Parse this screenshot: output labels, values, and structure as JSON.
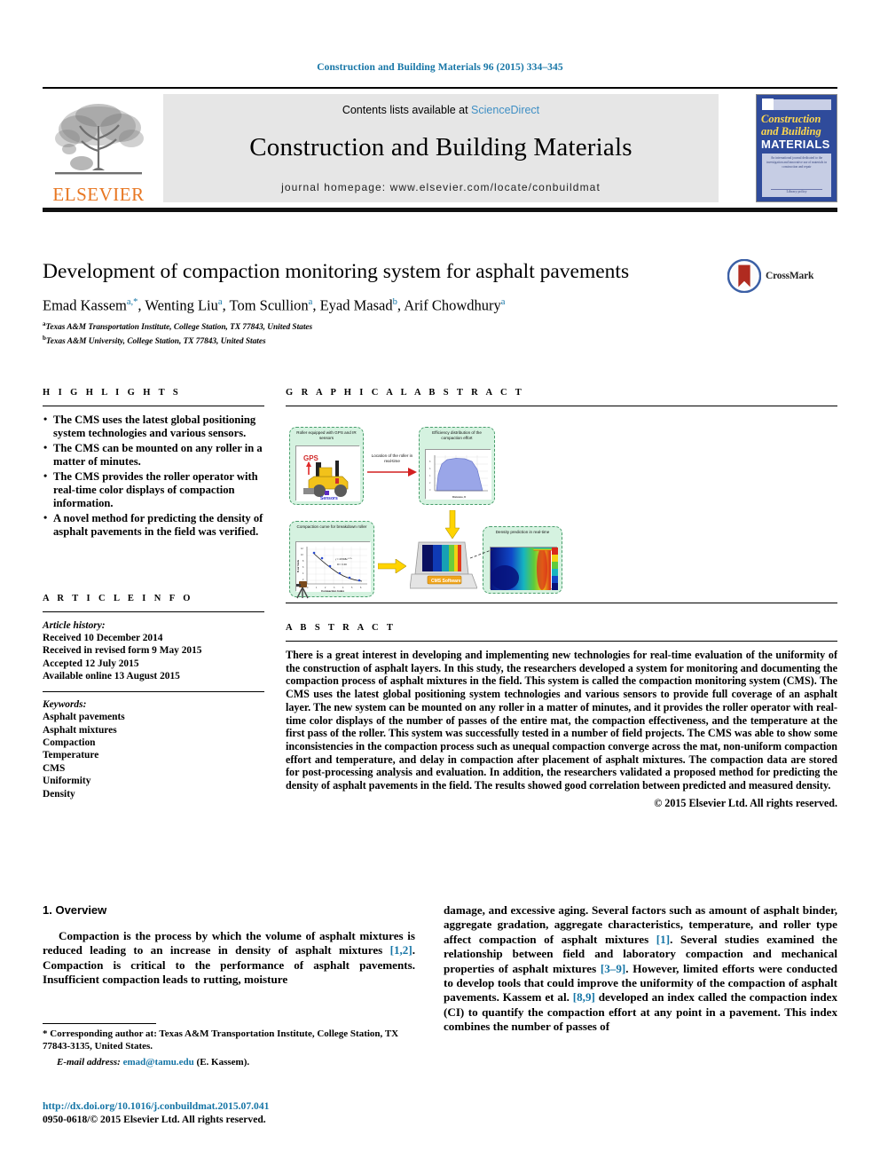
{
  "running_head": "Construction and Building Materials 96 (2015) 334–345",
  "masthead": {
    "contents_prefix": "Contents lists available at ",
    "sciencedirect": "ScienceDirect",
    "journal_title": "Construction and Building Materials",
    "homepage": "journal homepage: www.elsevier.com/locate/conbuildmat",
    "publisher": "ELSEVIER",
    "cover": {
      "line1": "Construction",
      "line2": "and Building",
      "line3": "MATERIALS",
      "blurb": "An international journal dedicated to the investigation and innovative use of materials in construction and repair",
      "foot": "Library policy"
    }
  },
  "article": {
    "title": "Development of compaction monitoring system for asphalt pavements",
    "crossmark_label": "CrossMark",
    "authors": [
      {
        "name": "Emad Kassem",
        "marks": "a,*"
      },
      {
        "name": "Wenting Liu",
        "marks": "a"
      },
      {
        "name": "Tom Scullion",
        "marks": "a"
      },
      {
        "name": "Eyad Masad",
        "marks": "b"
      },
      {
        "name": "Arif Chowdhury",
        "marks": "a"
      }
    ],
    "affiliations": [
      {
        "mark": "a",
        "text": "Texas A&M Transportation Institute, College Station, TX 77843, United States"
      },
      {
        "mark": "b",
        "text": "Texas A&M University, College Station, TX 77843, United States"
      }
    ]
  },
  "highlights": {
    "heading": "H I G H L I G H T S",
    "items": [
      "The CMS uses the latest global positioning system technologies and various sensors.",
      "The CMS can be mounted on any roller in a matter of minutes.",
      "The CMS provides the roller operator with real-time color displays of compaction information.",
      "A novel method for predicting the density of asphalt pavements in the field was verified."
    ]
  },
  "article_info": {
    "heading": "A R T I C L E    I N F O",
    "history_label": "Article history:",
    "history": [
      "Received 10 December 2014",
      "Received in revised form 9 May 2015",
      "Accepted 12 July 2015",
      "Available online 13 August 2015"
    ],
    "keywords_label": "Keywords:",
    "keywords": [
      "Asphalt pavements",
      "Asphalt mixtures",
      "Compaction",
      "Temperature",
      "CMS",
      "Uniformity",
      "Density"
    ]
  },
  "graphical_abstract": {
    "heading": "G R A P H I C A L   A B S T R A C T",
    "panels": {
      "roller": "Roller equipped with GPS and IR sensors",
      "roller_gps_label": "GPS",
      "roller_sensor_label": "Sensors",
      "efficiency": "Efficiency distribution of the compaction effort",
      "arrow_label": "Location of the roller in real-time",
      "compaction_curve": "Compaction curve for breakdown roller",
      "curve_eq": "y = 18.838e",
      "curve_exp": "-0.27x",
      "curve_r2": "R² = 0.93",
      "curve_ylabel": "% Air Voids",
      "curve_xlabel": "Compaction Index",
      "density": "Density prediction in real-time",
      "laptop_label": "CMS Software"
    }
  },
  "abstract": {
    "heading": "A B S T R A C T",
    "body": "There is a great interest in developing and implementing new technologies for real-time evaluation of the uniformity of the construction of asphalt layers. In this study, the researchers developed a system for monitoring and documenting the compaction process of asphalt mixtures in the field. This system is called the compaction monitoring system (CMS). The CMS uses the latest global positioning system technologies and various sensors to provide full coverage of an asphalt layer. The new system can be mounted on any roller in a matter of minutes, and it provides the roller operator with real-time color displays of the number of passes of the entire mat, the compaction effectiveness, and the temperature at the first pass of the roller. This system was successfully tested in a number of field projects. The CMS was able to show some inconsistencies in the compaction process such as unequal compaction converge across the mat, non-uniform compaction effort and temperature, and delay in compaction after placement of asphalt mixtures. The compaction data are stored for post-processing analysis and evaluation. In addition, the researchers validated a proposed method for predicting the density of asphalt pavements in the field. The results showed good correlation between predicted and measured density.",
    "copyright": "© 2015 Elsevier Ltd. All rights reserved."
  },
  "section": {
    "heading": "1. Overview",
    "left_paragraph_1": "Compaction is the process by which the volume of asphalt mixtures is reduced leading to an increase in density of asphalt mixtures ",
    "left_ref_1": "[1,2]",
    "left_paragraph_1b": ". Compaction is critical to the performance of asphalt pavements. Insufficient compaction leads to rutting, moisture",
    "right_paragraph_1": "damage, and excessive aging. Several factors such as amount of asphalt binder, aggregate gradation, aggregate characteristics, temperature, and roller type affect compaction of asphalt mixtures ",
    "right_ref_1": "[1]",
    "right_paragraph_1b": ". Several studies examined the relationship between field and laboratory compaction and mechanical properties of asphalt mixtures ",
    "right_ref_2": "[3–9]",
    "right_paragraph_1c": ". However, limited efforts were conducted to develop tools that could improve the uniformity of the compaction of asphalt pavements. Kassem et al. ",
    "right_ref_3": "[8,9]",
    "right_paragraph_1d": " developed an index called the compaction index (CI) to quantify the compaction effort at any point in a pavement. This index combines the number of passes of"
  },
  "footnote": {
    "corresponding": "* Corresponding author at: Texas A&M Transportation Institute, College Station, TX 77843-3135, United States.",
    "email_label": "E-mail address:",
    "email": "emad@tamu.edu",
    "email_suffix": " (E. Kassem).",
    "doi": "http://dx.doi.org/10.1016/j.conbuildmat.2015.07.041",
    "issn": "0950-0618/© 2015 Elsevier Ltd. All rights reserved."
  },
  "colors": {
    "link": "#1575a6",
    "sciencedirect": "#3f8fc4",
    "elsevier_orange": "#E87722",
    "cover_blue": "#2f4b9b",
    "ga_panel": "#d5f2e0"
  }
}
